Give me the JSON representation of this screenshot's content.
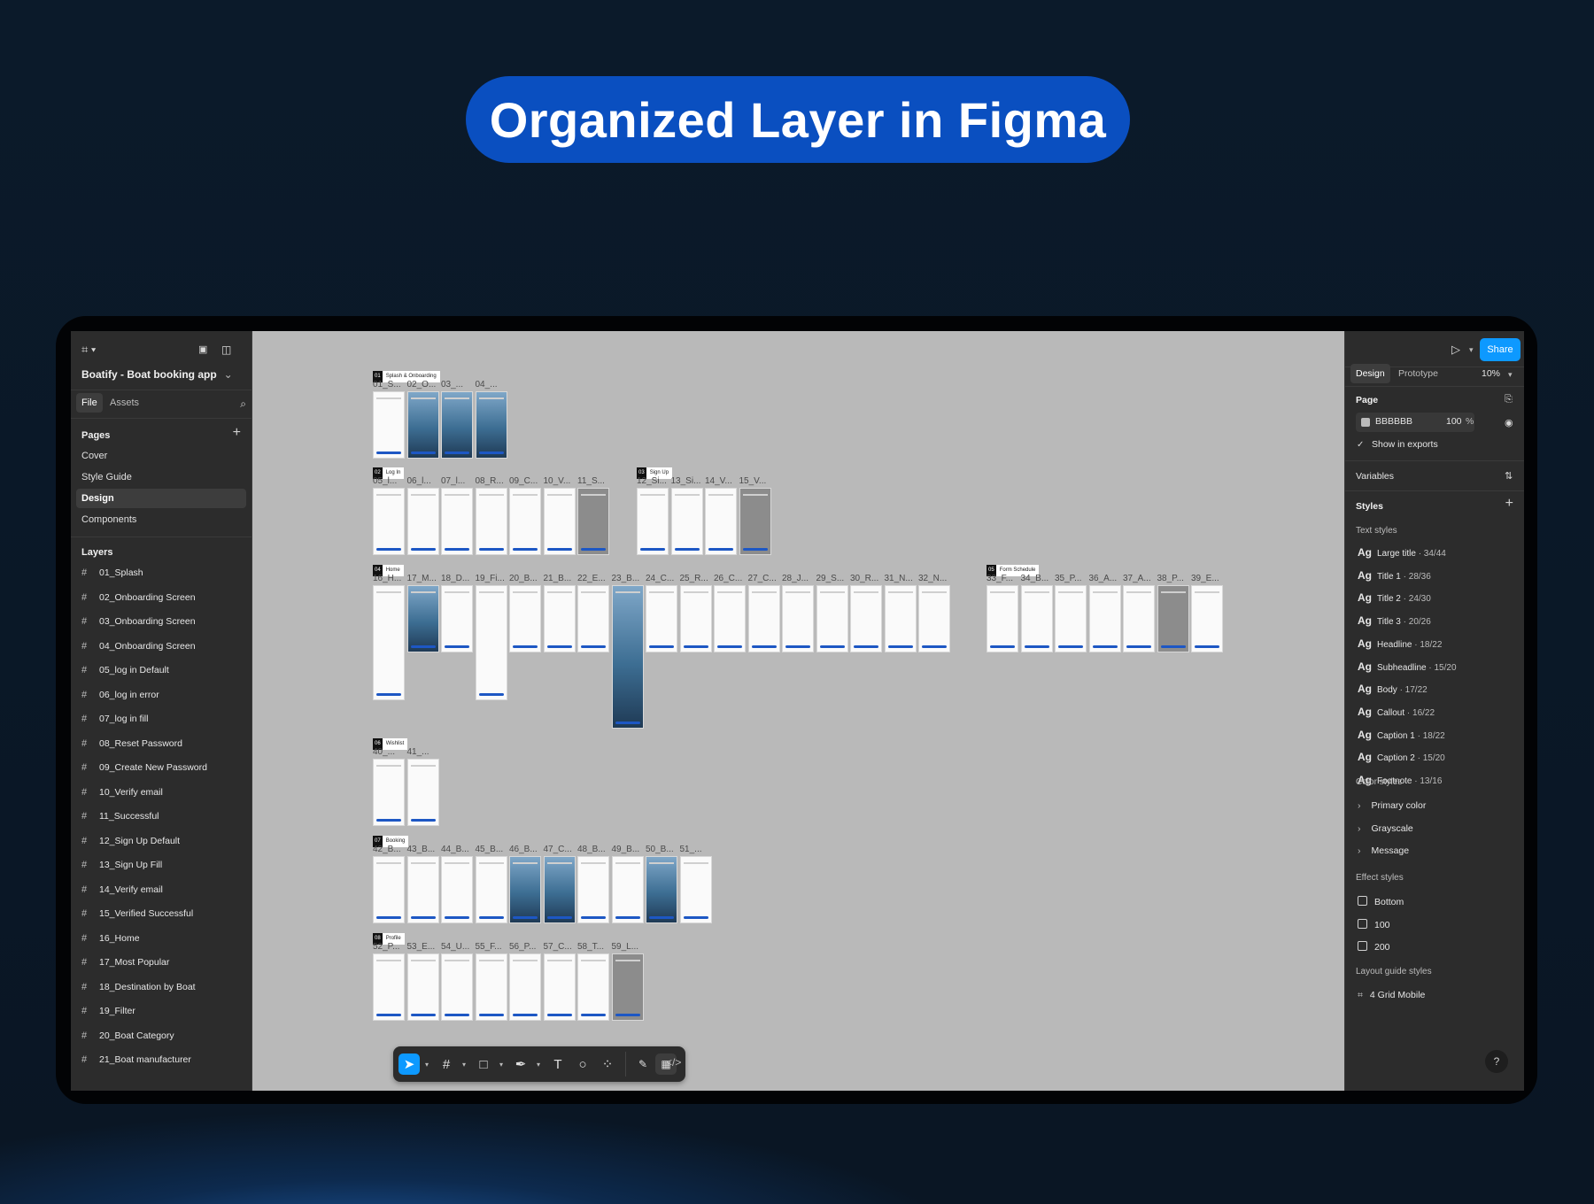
{
  "headline": "Organized Layer in Figma",
  "left_panel": {
    "file_name": "Boatify - Boat booking app",
    "tabs": [
      "File",
      "Assets"
    ],
    "pages_title": "Pages",
    "pages": [
      "Cover",
      "Style Guide",
      "Design",
      "Components"
    ],
    "selected_page": "Design",
    "layers_title": "Layers",
    "layers": [
      "01_Splash",
      "02_Onboarding Screen",
      "03_Onboarding Screen",
      "04_Onboarding Screen",
      "05_log in Default",
      "06_log in error",
      "07_log in fill",
      "08_Reset Password",
      "09_Create New Password",
      "10_Verify email",
      "11_Successful",
      "12_Sign Up Default",
      "13_Sign Up Fill",
      "14_Verify email",
      "15_Verified Successful",
      "16_Home",
      "17_Most Popular",
      "18_Destination by Boat",
      "19_Filter",
      "20_Boat Category",
      "21_Boat manufacturer"
    ]
  },
  "right_panel": {
    "share_label": "Share",
    "tabs": [
      "Design",
      "Prototype"
    ],
    "zoom": "10%",
    "page_title": "Page",
    "page_color_hex": "BBBBBB",
    "page_opacity": "100",
    "percent_sign": "%",
    "show_in_exports": "Show in exports",
    "variables_title": "Variables",
    "styles_title": "Styles",
    "text_styles_title": "Text styles",
    "text_styles": [
      {
        "name": "Large title",
        "meta": "34/44"
      },
      {
        "name": "Title 1",
        "meta": "28/36"
      },
      {
        "name": "Title 2",
        "meta": "24/30"
      },
      {
        "name": "Title 3",
        "meta": "20/26"
      },
      {
        "name": "Headline",
        "meta": "18/22"
      },
      {
        "name": "Subheadline",
        "meta": "15/20"
      },
      {
        "name": "Body",
        "meta": "17/22"
      },
      {
        "name": "Callout",
        "meta": "16/22"
      },
      {
        "name": "Caption 1",
        "meta": "18/22"
      },
      {
        "name": "Caption 2",
        "meta": "15/20"
      },
      {
        "name": "Footnote",
        "meta": "13/16"
      }
    ],
    "ag_label": "Ag",
    "color_styles_title": "Color styles",
    "color_styles": [
      "Primary color",
      "Grayscale",
      "Message"
    ],
    "effect_styles_title": "Effect styles",
    "effect_styles": [
      "Bottom",
      "100",
      "200"
    ],
    "layout_guide_title": "Layout guide styles",
    "layout_guides": [
      "4 Grid Mobile"
    ],
    "help": "?"
  },
  "canvas": {
    "sections": [
      {
        "num": "01",
        "name": "Splash & Onboarding"
      },
      {
        "num": "02",
        "name": "Log In"
      },
      {
        "num": "03",
        "name": "Sign Up"
      },
      {
        "num": "04",
        "name": "Home"
      },
      {
        "num": "05",
        "name": "Form Schedule"
      },
      {
        "num": "06",
        "name": "Wishlist"
      },
      {
        "num": "07",
        "name": "Booking"
      },
      {
        "num": "08",
        "name": "Profile"
      }
    ],
    "frame_labels": {
      "r1": [
        "01_S...",
        "02_O...",
        "03_...",
        "04_..."
      ],
      "r2a": [
        "05_l...",
        "06_l...",
        "07_l...",
        "08_R...",
        "09_C...",
        "10_V...",
        "11_S..."
      ],
      "r2b": [
        "12_Si...",
        "13_Si...",
        "14_V...",
        "15_V..."
      ],
      "r3a": [
        "16_H...",
        "17_M...",
        "18_D...",
        "19_Fi...",
        "20_B...",
        "21_B...",
        "22_E...",
        "23_B...",
        "24_C...",
        "25_R...",
        "26_C...",
        "27_C...",
        "28_J...",
        "29_S...",
        "30_R...",
        "31_N...",
        "32_N..."
      ],
      "r3b": [
        "33_F...",
        "34_B...",
        "35_P...",
        "36_A...",
        "37_A...",
        "38_P...",
        "39_E..."
      ],
      "r4": [
        "40_...",
        "41_..."
      ],
      "r5": [
        "42_B...",
        "43_B...",
        "44_B...",
        "45_B...",
        "46_B...",
        "47_C...",
        "48_B...",
        "49_B...",
        "50_B...",
        "51_..."
      ],
      "r6": [
        "52_P...",
        "53_E...",
        "54_U...",
        "55_F...",
        "56_P...",
        "57_C...",
        "58_T...",
        "59_L..."
      ]
    }
  },
  "toolbar": {
    "tools": [
      "move-icon",
      "frame-icon",
      "rectangle-icon",
      "pen-icon",
      "text-icon",
      "comment-icon",
      "actions-icon",
      "draw-icon",
      "design-icon",
      "dev-mode-icon"
    ]
  },
  "colors": {
    "accent": "#0d99ff",
    "headline_pill": "#0a4fc0",
    "canvas": "#BBBBBB"
  }
}
